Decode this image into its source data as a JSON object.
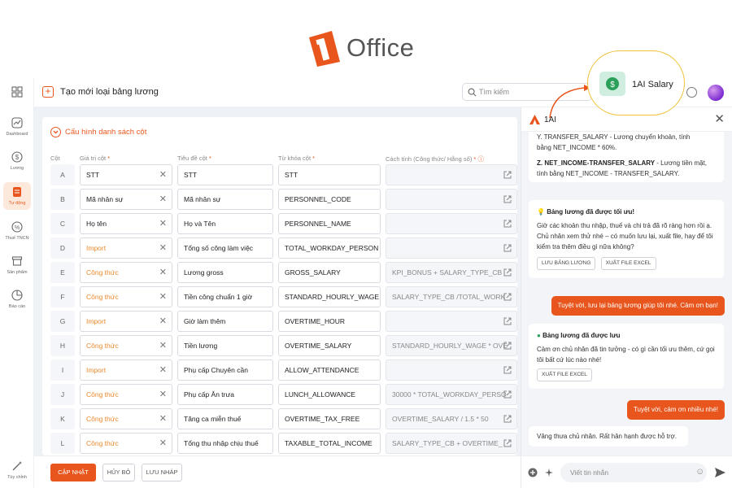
{
  "brand": {
    "name": "Office",
    "accent": "#e8561e"
  },
  "header": {
    "title": "Tạo mới loại bảng lương",
    "search_placeholder": "Tìm kiếm"
  },
  "rail": [
    {
      "label": "Dashboard",
      "icon": "dashboard-icon"
    },
    {
      "label": "Lương",
      "icon": "dollar-icon"
    },
    {
      "label": "Tự động",
      "icon": "document-icon",
      "active": true
    },
    {
      "label": "Thuế TNCN",
      "icon": "percent-icon"
    },
    {
      "label": "Sản phẩm",
      "icon": "box-icon"
    },
    {
      "label": "Báo cáo",
      "icon": "pie-chart-icon"
    },
    {
      "label": "Tùy chỉnh",
      "icon": "magic-wand-icon"
    }
  ],
  "config": {
    "title": "Cấu hình danh sách cột",
    "headers": {
      "col": "Cột",
      "value": "Giá trị cột",
      "title": "Tiêu đề cột",
      "key": "Từ khóa cột",
      "calc": "Cách tính (Công thức/ Hằng số)"
    },
    "rows": [
      {
        "letter": "A",
        "value": "STT",
        "title": "STT",
        "key": "STT",
        "calc": "",
        "orange": false
      },
      {
        "letter": "B",
        "value": "Mã nhân sự",
        "title": "Mã nhân sự",
        "key": "PERSONNEL_CODE",
        "calc": "",
        "orange": false
      },
      {
        "letter": "C",
        "value": "Họ tên",
        "title": "Họ và Tên",
        "key": "PERSONNEL_NAME",
        "calc": "",
        "orange": false
      },
      {
        "letter": "D",
        "value": "Import",
        "title": "Tổng số công làm việc",
        "key": "TOTAL_WORKDAY_PERSON",
        "calc": "",
        "orange": true
      },
      {
        "letter": "E",
        "value": "Công thức",
        "title": "Lương gross",
        "key": "GROSS_SALARY",
        "calc": "KPI_BONUS + SALARY_TYPE_CB",
        "orange": true
      },
      {
        "letter": "F",
        "value": "Công thức",
        "title": "Tiền công chuẩn 1 giờ",
        "key": "STANDARD_HOURLY_WAGE",
        "calc": "SALARY_TYPE_CB /TOTAL_WORK",
        "orange": true
      },
      {
        "letter": "G",
        "value": "Import",
        "title": "Giờ làm thêm",
        "key": "OVERTIME_HOUR",
        "calc": "",
        "orange": true
      },
      {
        "letter": "H",
        "value": "Công thức",
        "title": "Tiền lương",
        "key": "OVERTIME_SALARY",
        "calc": "STANDARD_HOURLY_WAGE * OVE",
        "orange": true
      },
      {
        "letter": "I",
        "value": "Import",
        "title": "Phụ cấp Chuyên cần",
        "key": "ALLOW_ATTENDANCE",
        "calc": "",
        "orange": true
      },
      {
        "letter": "J",
        "value": "Công thức",
        "title": "Phụ cấp Ăn trưa",
        "key": "LUNCH_ALLOWANCE",
        "calc": "30000 * TOTAL_WORKDAY_PERSO",
        "orange": true
      },
      {
        "letter": "K",
        "value": "Công thức",
        "title": "Tăng ca miễn thuế",
        "key": "OVERTIME_TAX_FREE",
        "calc": "OVERTIME_SALARY / 1.5 * 50",
        "orange": true
      },
      {
        "letter": "L",
        "value": "Công thức",
        "title": "Tổng thu nhập chịu thuế",
        "key": "TAXABLE_TOTAL_INCOME",
        "calc": "SALARY_TYPE_CB + OVERTIME_",
        "orange": true
      }
    ]
  },
  "footer": {
    "update": "CẬP NHẬT",
    "cancel": "HỦY BỎ",
    "draft": "LƯU NHÁP"
  },
  "chat": {
    "title": "1AI",
    "badge": "1AI Salary",
    "bot1_line1": "Y. TRANSFER_SALARY - Lương chuyển khoản, tính",
    "bot1_line2": "bằng NET_INCOME * 60%.",
    "bot1_z": "Z. NET_INCOME-TRANSFER_SALARY",
    "bot1_z_rest": " - Lương tiền mặt, tính bằng NET_INCOME - TRANSFER_SALARY.",
    "opt_title": "Bảng lương đã được tối ưu!",
    "opt_text": "Giờ các khoản thu nhập, thuế và chi trả đã rõ ràng hơn rồi ạ. Chủ nhân xem thử nhé – có muốn lưu lại, xuất file, hay để tôi kiểm tra thêm điều gì nữa không?",
    "btn_save": "LƯU BẢNG LƯƠNG",
    "btn_export": "XUẤT FILE EXCEL",
    "user1": "Tuyệt vời, lưu lại bảng lương giúp tôi nhé. Cảm ơn bạn!",
    "saved_title": "Bảng lương đã được lưu",
    "saved_text": "Cảm ơn chủ nhân đã tin tưởng - có gì cần tối ưu thêm, cứ gọi tôi bất cứ lúc nào nhé!",
    "btn_export2": "XUẤT FILE EXCEL",
    "user2": "Tuyệt vời, cảm ơn nhiều nhé!",
    "bot_last": "Vâng thưa chủ nhân. Rất hân hạnh được hỗ trợ.",
    "input_placeholder": "Viết tin nhắn"
  }
}
